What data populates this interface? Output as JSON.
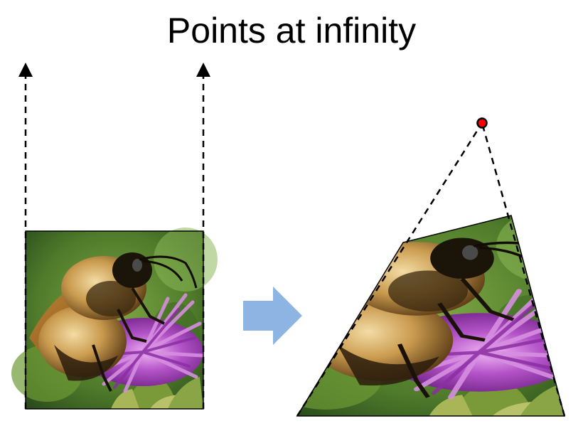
{
  "slide": {
    "title": "Points at infinity"
  },
  "image": {
    "subject": "bumblebee-on-purple-aster-photo"
  },
  "arrow": {
    "color": "#8EB4E3",
    "icon": "right-block-arrow-icon"
  },
  "vanishing_point": {
    "fill_color": "#FF0000",
    "stroke_color": "#000000"
  },
  "lines": {
    "color": "#000000",
    "style": "dashed"
  }
}
